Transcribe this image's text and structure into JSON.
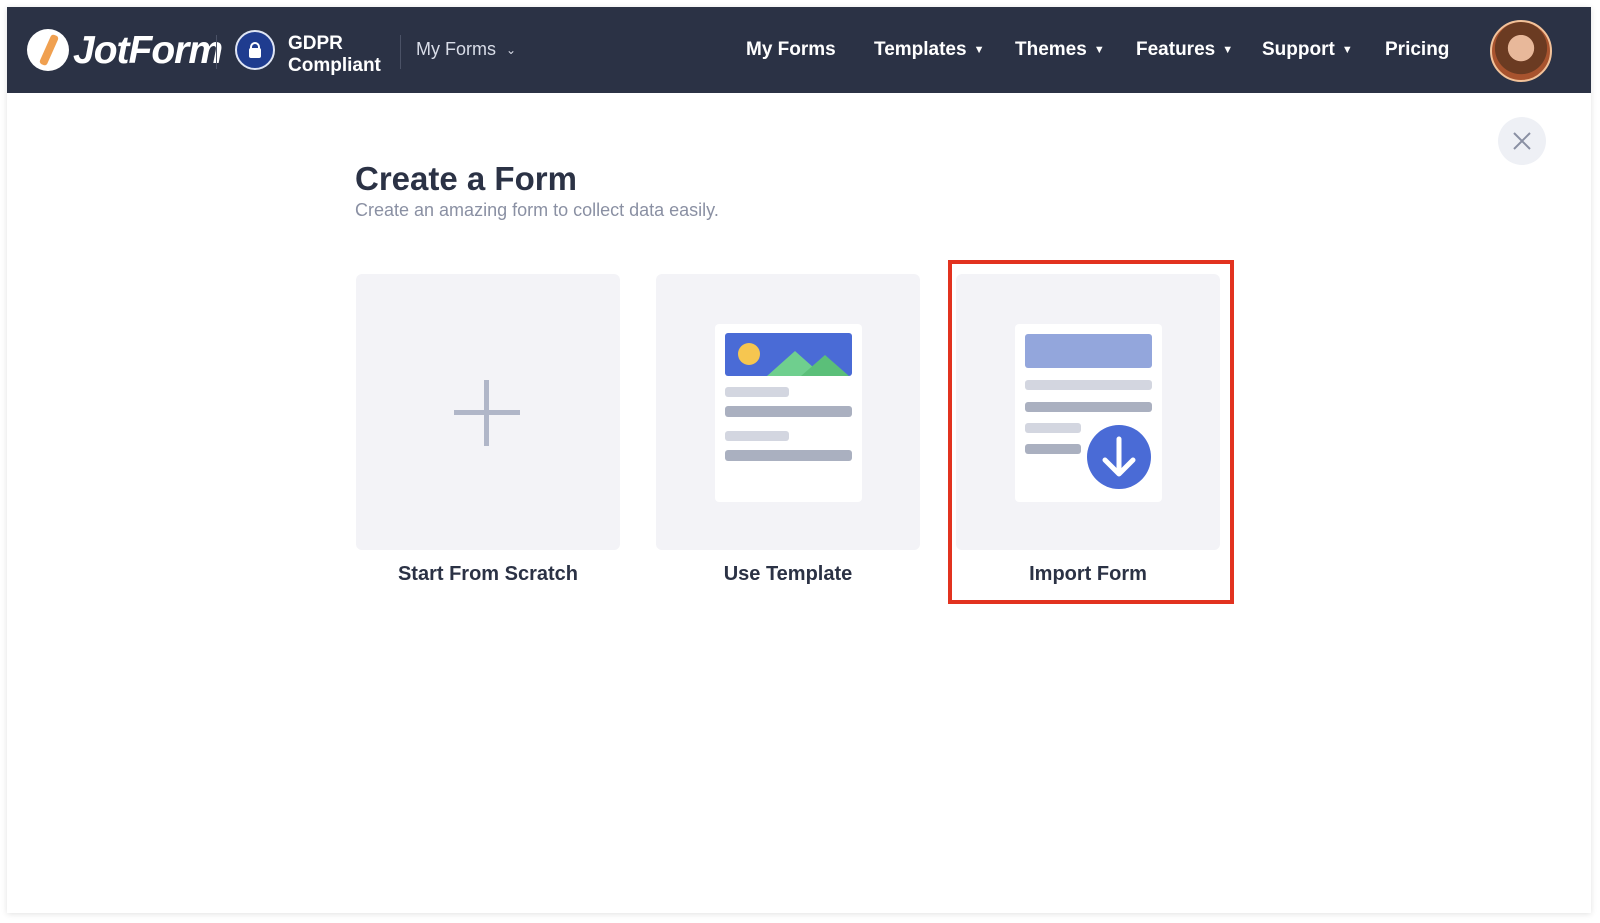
{
  "navbar": {
    "brand": "JotForm",
    "gdpr_line1": "GDPR",
    "gdpr_line2": "Compliant",
    "myforms_dropdown": "My Forms",
    "links": [
      {
        "label": "My Forms",
        "has_caret": false
      },
      {
        "label": "Templates",
        "has_caret": true
      },
      {
        "label": "Themes",
        "has_caret": true
      },
      {
        "label": "Features",
        "has_caret": true
      },
      {
        "label": "Support",
        "has_caret": true
      },
      {
        "label": "Pricing",
        "has_caret": false
      }
    ]
  },
  "dialog": {
    "title": "Create a Form",
    "subtitle": "Create an amazing form to collect data easily.",
    "options": [
      {
        "label": "Start From Scratch",
        "icon": "plus-icon"
      },
      {
        "label": "Use Template",
        "icon": "template-icon"
      },
      {
        "label": "Import Form",
        "icon": "import-icon",
        "highlighted": true
      }
    ]
  },
  "colors": {
    "navbar_bg": "#2b3245",
    "highlight_border": "#e2321f",
    "accent_blue": "#4a6bd6"
  }
}
